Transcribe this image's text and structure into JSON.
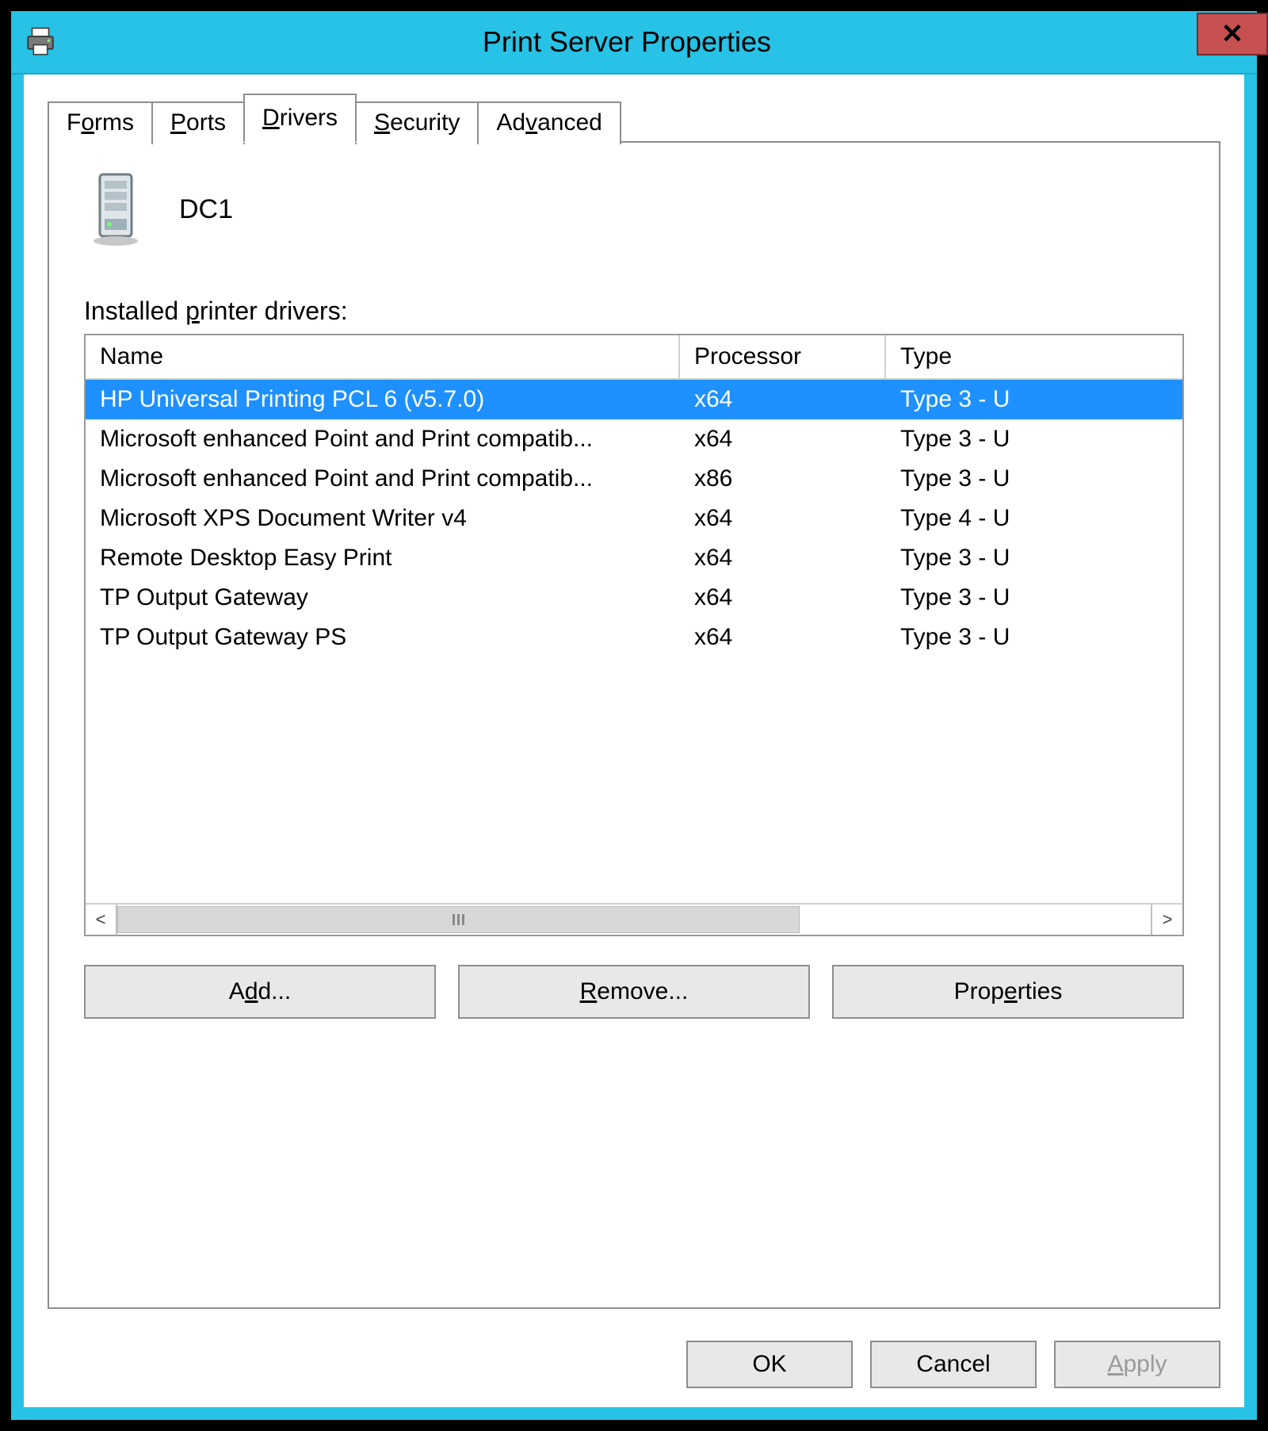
{
  "window": {
    "title": "Print Server Properties",
    "close_glyph": "✕"
  },
  "tabs": {
    "items": [
      {
        "label_pre": "F",
        "label_u": "o",
        "label_post": "rms"
      },
      {
        "label_pre": "",
        "label_u": "P",
        "label_post": "orts"
      },
      {
        "label_pre": "",
        "label_u": "D",
        "label_post": "rivers"
      },
      {
        "label_pre": "",
        "label_u": "S",
        "label_post": "ecurity"
      },
      {
        "label_pre": "Ad",
        "label_u": "v",
        "label_post": "anced"
      }
    ],
    "active_index": 2
  },
  "panel": {
    "server_name": "DC1",
    "list_label_pre": "Installed ",
    "list_label_u": "p",
    "list_label_post": "rinter drivers:",
    "columns": {
      "name": "Name",
      "processor": "Processor",
      "type": "Type"
    },
    "rows": [
      {
        "name": "HP Universal Printing PCL 6 (v5.7.0)",
        "processor": "x64",
        "type": "Type 3 - U",
        "selected": true
      },
      {
        "name": "Microsoft enhanced Point and Print compatib...",
        "processor": "x64",
        "type": "Type 3 - U",
        "selected": false
      },
      {
        "name": "Microsoft enhanced Point and Print compatib...",
        "processor": "x86",
        "type": "Type 3 - U",
        "selected": false
      },
      {
        "name": "Microsoft XPS Document Writer v4",
        "processor": "x64",
        "type": "Type 4 - U",
        "selected": false
      },
      {
        "name": "Remote Desktop Easy Print",
        "processor": "x64",
        "type": "Type 3 - U",
        "selected": false
      },
      {
        "name": "TP Output Gateway",
        "processor": "x64",
        "type": "Type 3 - U",
        "selected": false
      },
      {
        "name": "TP Output Gateway PS",
        "processor": "x64",
        "type": "Type 3 - U",
        "selected": false
      }
    ],
    "actions": {
      "add_pre": "A",
      "add_u": "d",
      "add_post": "d...",
      "rem_pre": "",
      "rem_u": "R",
      "rem_post": "emove...",
      "prop_pre": "Prop",
      "prop_u": "e",
      "prop_post": "rties"
    }
  },
  "dialog_buttons": {
    "ok": "OK",
    "cancel": "Cancel",
    "apply_pre": "",
    "apply_u": "A",
    "apply_post": "pply"
  },
  "scroll": {
    "left_glyph": "<",
    "right_glyph": ">"
  }
}
